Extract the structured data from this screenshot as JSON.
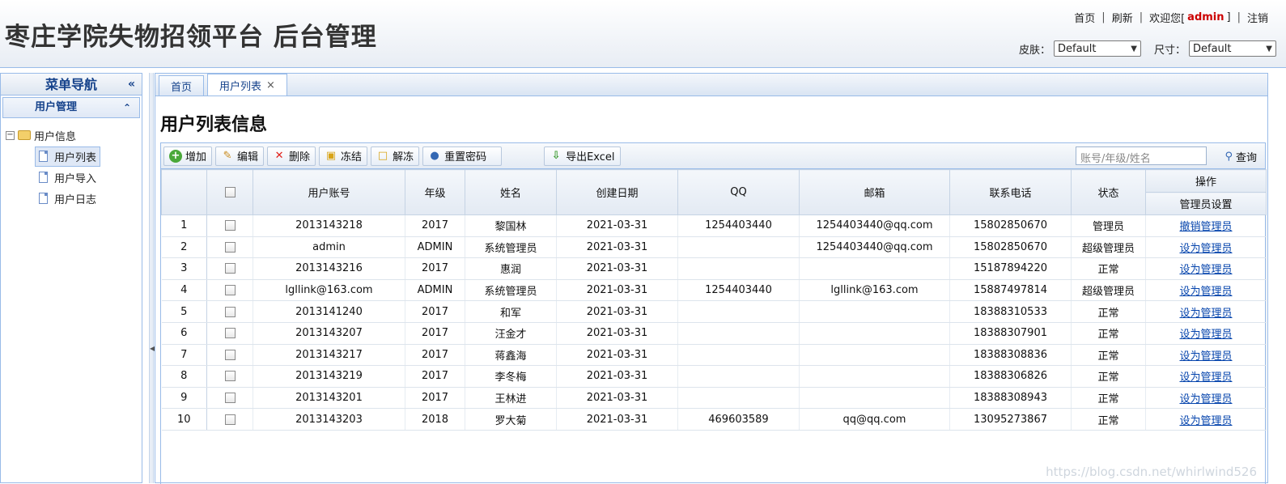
{
  "header": {
    "title": "枣庄学院失物招领平台 后台管理",
    "links": {
      "home": "首页",
      "refresh": "刷新",
      "welcome": "欢迎您[",
      "user": "admin",
      "welcome_end": "]",
      "logout": "注销"
    },
    "skin_label": "皮肤：",
    "skin_value": "Default",
    "size_label": "尺寸：",
    "size_value": "Default"
  },
  "sidebar": {
    "title": "菜单导航",
    "collapse_glyph": "«",
    "panel_title": "用户管理",
    "fold_glyph": "≈",
    "root_label": "用户信息",
    "root_toggle": "−",
    "items": [
      {
        "label": "用户列表",
        "selected": true
      },
      {
        "label": "用户导入",
        "selected": false
      },
      {
        "label": "用户日志",
        "selected": false
      }
    ]
  },
  "tabs": [
    {
      "label": "首页"
    },
    {
      "label": "用户列表",
      "close": "×"
    }
  ],
  "page_title": "用户列表信息",
  "toolbar": {
    "add": "增加",
    "edit": "编辑",
    "delete": "删除",
    "freeze": "冻结",
    "unfreeze": "解冻",
    "reset_password": "重置密码",
    "export": "导出Excel",
    "search_placeholder": "账号/年级/姓名",
    "query": "查询"
  },
  "table": {
    "columns": [
      "用户账号",
      "年级",
      "姓名",
      "创建日期",
      "QQ",
      "邮箱",
      "联系电话",
      "状态"
    ],
    "action_group": "操作",
    "action_sub": "管理员设置",
    "rows": [
      {
        "n": "1",
        "account": "2013143218",
        "grade": "2017",
        "name": "黎国林",
        "date": "2021-03-31",
        "qq": "1254403440",
        "email": "1254403440@qq.com",
        "phone": "15802850670",
        "status": "管理员",
        "action": "撤销管理员"
      },
      {
        "n": "2",
        "account": "admin",
        "grade": "ADMIN",
        "name": "系统管理员",
        "date": "2021-03-31",
        "qq": "",
        "email": "1254403440@qq.com",
        "phone": "15802850670",
        "status": "超级管理员",
        "action": "设为管理员"
      },
      {
        "n": "3",
        "account": "2013143216",
        "grade": "2017",
        "name": "惠润",
        "date": "2021-03-31",
        "qq": "",
        "email": "",
        "phone": "15187894220",
        "status": "正常",
        "action": "设为管理员"
      },
      {
        "n": "4",
        "account": "lgllink@163.com",
        "grade": "ADMIN",
        "name": "系统管理员",
        "date": "2021-03-31",
        "qq": "1254403440",
        "email": "lgllink@163.com",
        "phone": "15887497814",
        "status": "超级管理员",
        "action": "设为管理员"
      },
      {
        "n": "5",
        "account": "2013141240",
        "grade": "2017",
        "name": "和军",
        "date": "2021-03-31",
        "qq": "",
        "email": "",
        "phone": "18388310533",
        "status": "正常",
        "action": "设为管理员"
      },
      {
        "n": "6",
        "account": "2013143207",
        "grade": "2017",
        "name": "汪金才",
        "date": "2021-03-31",
        "qq": "",
        "email": "",
        "phone": "18388307901",
        "status": "正常",
        "action": "设为管理员"
      },
      {
        "n": "7",
        "account": "2013143217",
        "grade": "2017",
        "name": "蒋鑫海",
        "date": "2021-03-31",
        "qq": "",
        "email": "",
        "phone": "18388308836",
        "status": "正常",
        "action": "设为管理员"
      },
      {
        "n": "8",
        "account": "2013143219",
        "grade": "2017",
        "name": "李冬梅",
        "date": "2021-03-31",
        "qq": "",
        "email": "",
        "phone": "18388306826",
        "status": "正常",
        "action": "设为管理员"
      },
      {
        "n": "9",
        "account": "2013143201",
        "grade": "2017",
        "name": "王林进",
        "date": "2021-03-31",
        "qq": "",
        "email": "",
        "phone": "18388308943",
        "status": "正常",
        "action": "设为管理员"
      },
      {
        "n": "10",
        "account": "2013143203",
        "grade": "2018",
        "name": "罗大菊",
        "date": "2021-03-31",
        "qq": "469603589",
        "email": "qq@qq.com",
        "phone": "13095273867",
        "status": "正常",
        "action": "设为管理员"
      }
    ]
  },
  "watermark": "https://blog.csdn.net/whirlwind526",
  "colors": {
    "accent_border": "#99bbe8",
    "link": "#0645ad",
    "admin_name": "#cc0000"
  }
}
